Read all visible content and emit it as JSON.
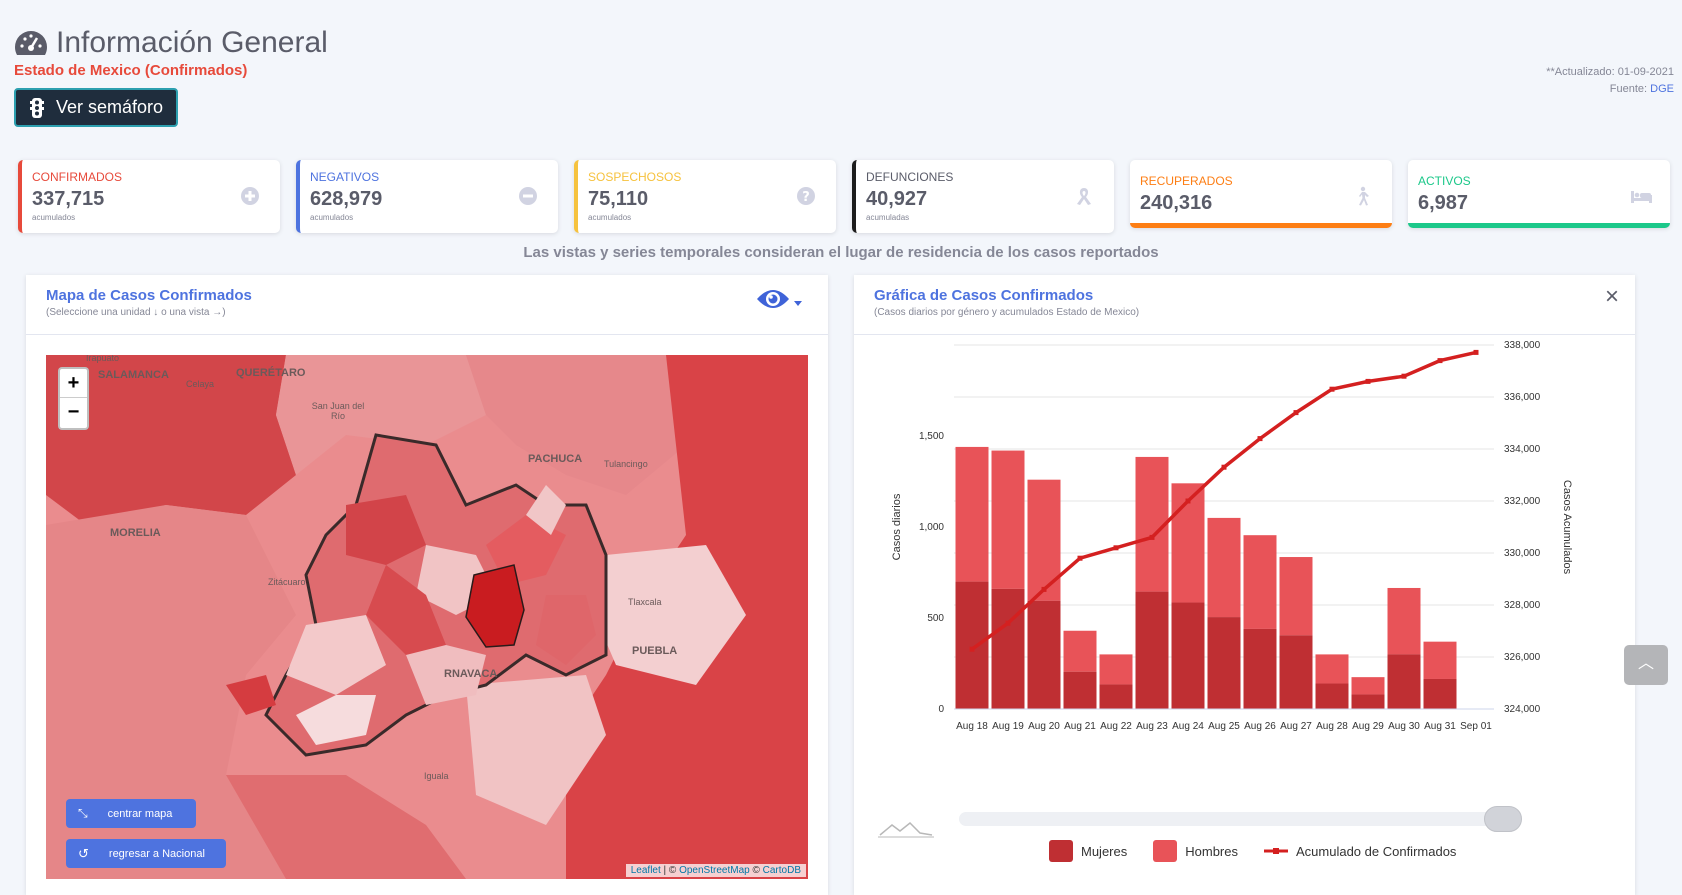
{
  "header": {
    "title": "Información General",
    "subtitle": "Estado de Mexico (Confirmados)",
    "semaforo_button": "Ver semáforo",
    "updated": "**Actualizado: 01-09-2021",
    "source_label": "Fuente:",
    "source_link": "DGE"
  },
  "stats": [
    {
      "label": "CONFIRMADOS",
      "value": "337,715",
      "sub": "acumulados",
      "color": "#e74a3b",
      "icon": "plus-circle-icon"
    },
    {
      "label": "NEGATIVOS",
      "value": "628,979",
      "sub": "acumulados",
      "color": "#4e73df",
      "icon": "minus-circle-icon"
    },
    {
      "label": "SOSPECHOSOS",
      "value": "75,110",
      "sub": "acumulados",
      "color": "#f6c23e",
      "icon": "question-circle-icon"
    },
    {
      "label": "DEFUNCIONES",
      "value": "40,927",
      "sub": "acumuladas",
      "color": "#1d1d1d",
      "icon": "ribbon-icon"
    },
    {
      "label": "RECUPERADOS",
      "value": "240,316",
      "color": "#fd7e14",
      "icon": "walking-icon"
    },
    {
      "label": "ACTIVOS",
      "value": "6,987",
      "color": "#1cc88a",
      "icon": "bed-icon"
    }
  ],
  "note": "Las vistas y series temporales consideran el lugar de residencia de los casos reportados",
  "map_panel": {
    "title": "Mapa de Casos Confirmados",
    "subtitle": "(Seleccione una unidad ↓ o una vista →)",
    "zoom_in": "+",
    "zoom_out": "−",
    "center_button": "centrar mapa",
    "national_button": "regresar a Nacional",
    "attribution_leaflet": "Leaflet",
    "attribution_osm": "OpenStreetMap",
    "attribution_carto": "CartoDB",
    "place_labels": {
      "salamanca": "SALAMANCA",
      "queretaro": "QUERÉTARO",
      "celaya": "Celaya",
      "irapuato": "Irapuato",
      "sanjuan": "San Juan del Río",
      "pachuca": "PACHUCA",
      "tulancingo": "Tulancingo",
      "morelia": "MORELIA",
      "zitacuaro": "Zitácuaro",
      "tlaxcala": "Tlaxcala",
      "puebla": "PUEBLA",
      "cuernavaca": "RNAVACA",
      "iguala": "Iguala"
    }
  },
  "chart_panel": {
    "title": "Gráfica de Casos Confirmados",
    "subtitle": "(Casos diarios por género y acumulados Estado de Mexico)",
    "close": "×"
  },
  "chart_data": {
    "type": "bar",
    "categories": [
      "Aug 18",
      "Aug 19",
      "Aug 20",
      "Aug 21",
      "Aug 22",
      "Aug 23",
      "Aug 24",
      "Aug 25",
      "Aug 26",
      "Aug 27",
      "Aug 28",
      "Aug 29",
      "Aug 30",
      "Aug 31",
      "Sep 01"
    ],
    "series": [
      {
        "name": "Mujeres",
        "color": "#bf2f33",
        "values": [
          700,
          660,
          595,
          205,
          135,
          645,
          585,
          505,
          440,
          405,
          140,
          80,
          300,
          165,
          0
        ]
      },
      {
        "name": "Hombres",
        "color": "#e85358",
        "values": [
          740,
          760,
          665,
          225,
          165,
          740,
          655,
          545,
          515,
          430,
          160,
          95,
          365,
          205,
          0
        ]
      },
      {
        "name": "Acumulado de Confirmados",
        "color": "#d42020",
        "axis": "right",
        "values": [
          326300,
          327300,
          328600,
          329800,
          330200,
          330600,
          332000,
          333300,
          334400,
          335400,
          336300,
          336600,
          336800,
          337400,
          337715
        ]
      }
    ],
    "ylabel": "Casos diarios",
    "y2label": "Casos Acumulados",
    "ylim": [
      0,
      2000
    ],
    "y_ticks": [
      "0",
      "500",
      "1,000",
      "1,500"
    ],
    "y2lim": [
      324000,
      338000
    ],
    "y2_ticks": [
      "324,000",
      "326,000",
      "328,000",
      "330,000",
      "332,000",
      "334,000",
      "336,000",
      "338,000"
    ],
    "grid": true,
    "legend_position": "bottom"
  }
}
